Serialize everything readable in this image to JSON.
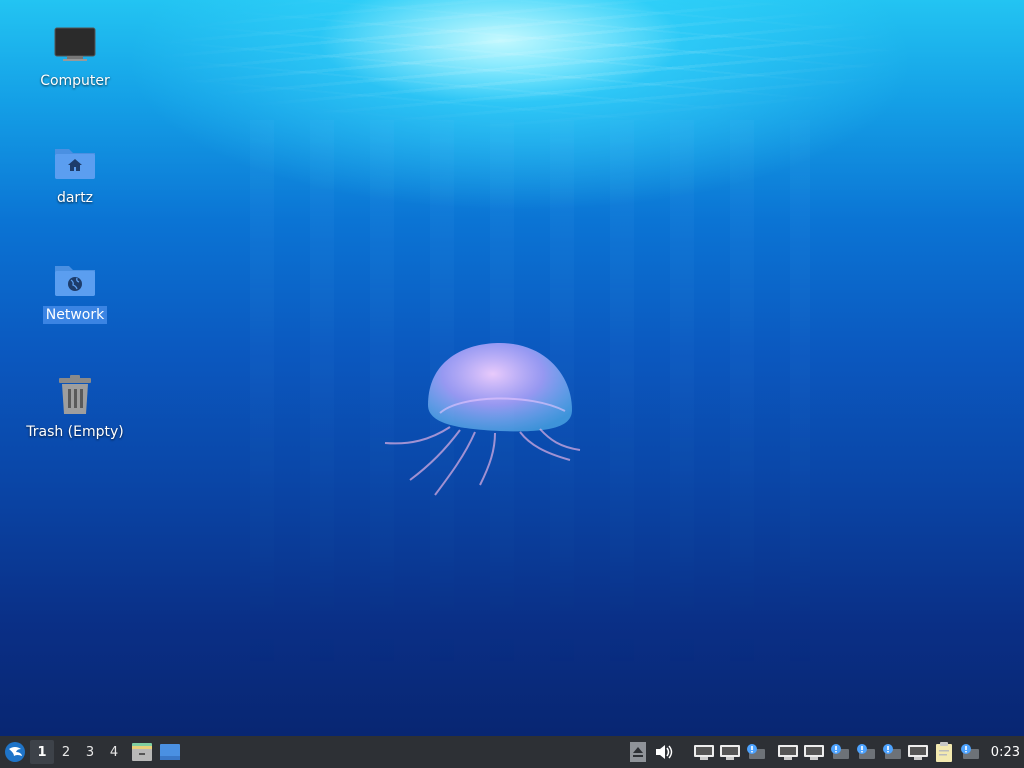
{
  "desktop": {
    "icons": [
      {
        "label": "Computer",
        "icon": "computer-icon",
        "selected": false
      },
      {
        "label": "dartz",
        "icon": "home-folder-icon",
        "selected": false
      },
      {
        "label": "Network",
        "icon": "network-folder-icon",
        "selected": true
      },
      {
        "label": "Trash (Empty)",
        "icon": "trash-icon",
        "selected": false
      }
    ]
  },
  "taskbar": {
    "menu_icon": "lubuntu-logo-icon",
    "workspaces": [
      {
        "label": "1",
        "active": true
      },
      {
        "label": "2",
        "active": false
      },
      {
        "label": "3",
        "active": false
      },
      {
        "label": "4",
        "active": false
      }
    ],
    "launchers": [
      "file-manager-icon",
      "show-desktop-icon"
    ],
    "tray_icons": [
      "eject-icon",
      "volume-icon",
      "network-wired-icon",
      "network-wired-icon",
      "network-notification-icon",
      "network-wired-icon",
      "network-wired-icon",
      "network-notification-icon",
      "network-notification-icon",
      "network-notification-icon",
      "network-wired-icon",
      "clipboard-icon",
      "network-notification-icon"
    ],
    "clock": "0:23"
  },
  "colors": {
    "panel_bg": "#2d3035",
    "selection": "#3b84e3",
    "accent": "#4a90e2"
  }
}
